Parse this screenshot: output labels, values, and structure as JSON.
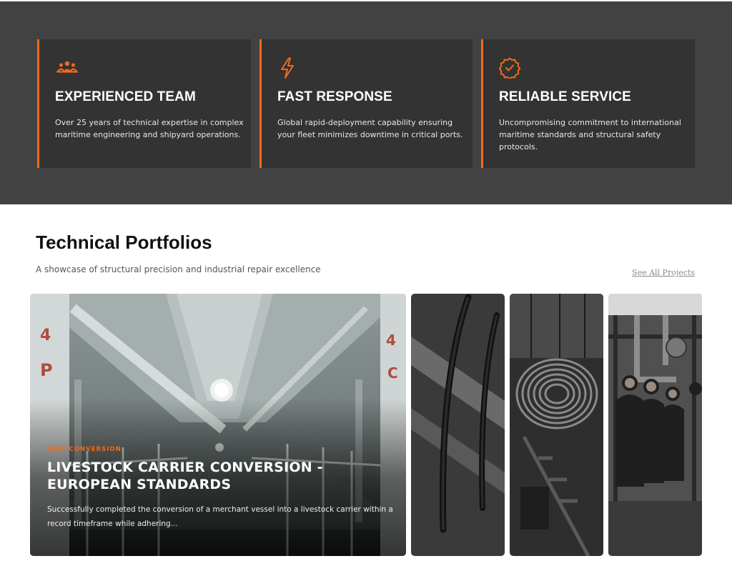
{
  "features": [
    {
      "icon": "team-icon",
      "title": "EXPERIENCED TEAM",
      "text": "Over 25 years of technical expertise in complex maritime engineering and shipyard operations."
    },
    {
      "icon": "lightning-icon",
      "title": "FAST RESPONSE",
      "text": "Global rapid-deployment capability ensuring your fleet minimizes downtime in critical ports."
    },
    {
      "icon": "verified-badge-icon",
      "title": "RELIABLE SERVICE",
      "text": "Uncompromising commitment to international maritime standards and structural safety protocols."
    }
  ],
  "portfolio": {
    "title": "Technical Portfolios",
    "subtitle": "A showcase of structural precision and industrial repair excellence",
    "see_all": "See All Projects",
    "featured": {
      "category": "SHIP CONVERSION",
      "title": "LIVESTOCK CARRIER CONVERSION - EUROPEAN STANDARDS",
      "description": "Successfully completed the conversion of a merchant vessel into a livestock carrier within a record timeframe while adhering..."
    }
  },
  "colors": {
    "accent": "#f26a1b",
    "dark_band": "#424242",
    "card_bg": "#333333"
  }
}
